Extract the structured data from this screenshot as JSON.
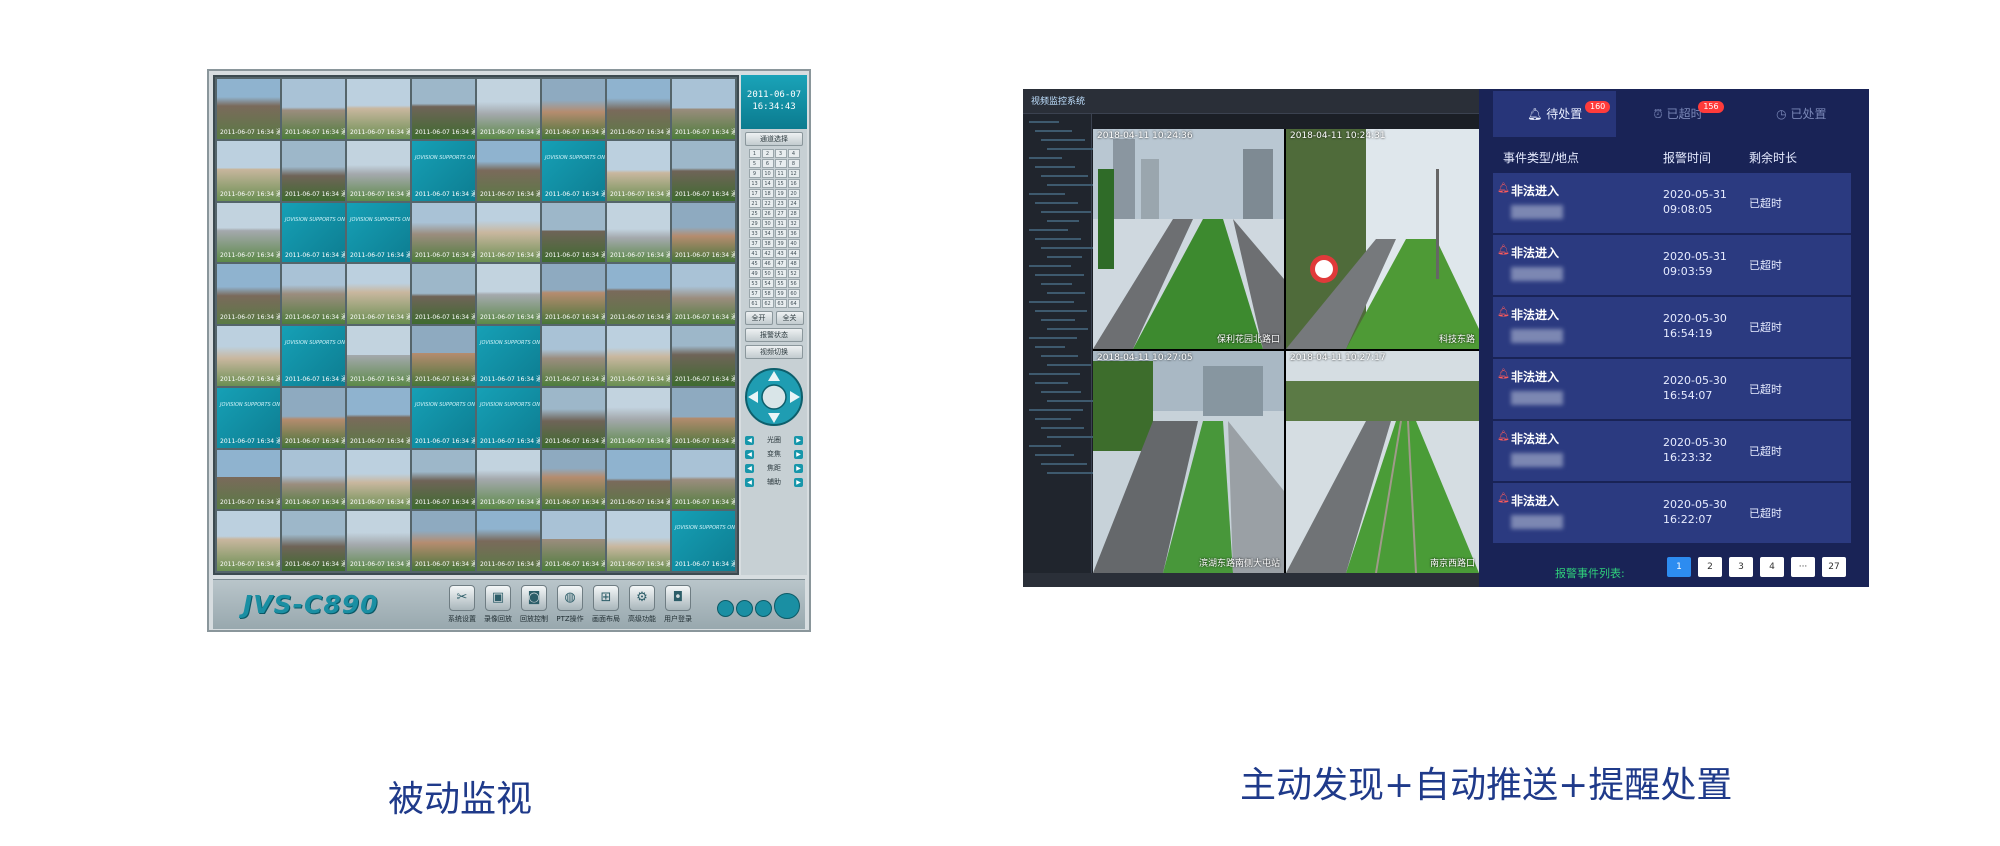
{
  "left_client": {
    "clock_date": "2011-06-07",
    "clock_time": "16:34:43",
    "logo": "JVS-C890",
    "side_buttons": [
      "通道选择",
      "全开",
      "全关",
      "报警状态",
      "视频切换"
    ],
    "ptz_labels": [
      "光圈",
      "变焦",
      "焦距",
      "辅助"
    ],
    "toolbar": [
      "系统设置",
      "录像回放",
      "回放控制",
      "PTZ操作",
      "画面布局",
      "高级功能",
      "用户登录"
    ],
    "cell_caption": "2011-06-07 16:34 通道",
    "brand_caption": "JOVISION SUPPORTS ONLINE"
  },
  "right_system": {
    "app_title": "视频监控系统",
    "views": [
      {
        "caption_top": "2018-04-11 10:24:36",
        "caption_bottom": "保利花园北路口"
      },
      {
        "caption_top": "2018-04-11 10:24:31",
        "caption_bottom": "科技东路"
      },
      {
        "caption_top": "2018-04-11 10:27:05",
        "caption_bottom": "滨湖东路南侧大屯站"
      },
      {
        "caption_top": "2018-04-11 10:27:17",
        "caption_bottom": "南京西路口"
      }
    ],
    "tabs": [
      {
        "label": "待处置",
        "badge": "160"
      },
      {
        "label": "已超时",
        "badge": "156"
      },
      {
        "label": "已处置",
        "badge": ""
      }
    ],
    "columns": [
      "事件类型/地点",
      "报警时间",
      "剩余时长"
    ],
    "events": [
      {
        "type": "非法进入",
        "date": "2020-05-31",
        "time": "09:08:05",
        "remain": "已超时"
      },
      {
        "type": "非法进入",
        "date": "2020-05-31",
        "time": "09:03:59",
        "remain": "已超时"
      },
      {
        "type": "非法进入",
        "date": "2020-05-30",
        "time": "16:54:19",
        "remain": "已超时"
      },
      {
        "type": "非法进入",
        "date": "2020-05-30",
        "time": "16:54:07",
        "remain": "已超时"
      },
      {
        "type": "非法进入",
        "date": "2020-05-30",
        "time": "16:23:32",
        "remain": "已超时"
      },
      {
        "type": "非法进入",
        "date": "2020-05-30",
        "time": "16:22:07",
        "remain": "已超时"
      }
    ],
    "pager_label": "报警事件列表:",
    "pages": [
      "1",
      "2",
      "3",
      "4",
      "···",
      "27"
    ],
    "current_page": "1"
  },
  "captions": {
    "left": "被动监视",
    "right": "主动发现+自动推送+提醒处置"
  },
  "colors": {
    "caption": "#1f3a8a",
    "panel_bg": "#192356",
    "row_bg": "#2b3a80",
    "accent_teal": "#1a8fa3",
    "badge_red": "#ff3b3b",
    "pager_active": "#2d8cf0",
    "pager_label": "#2fd07b"
  }
}
